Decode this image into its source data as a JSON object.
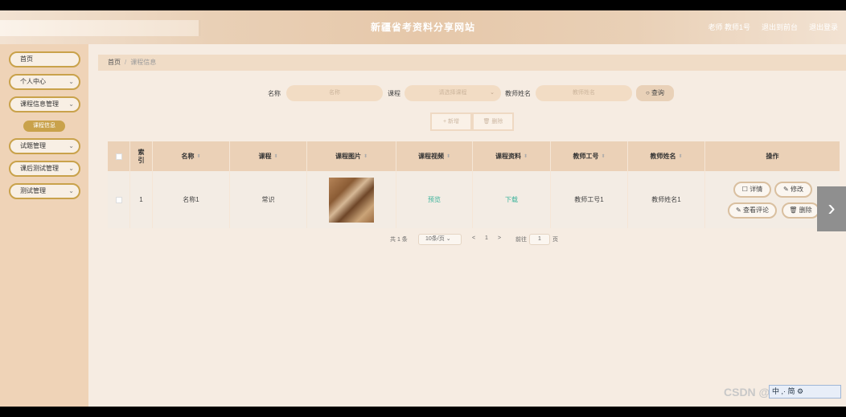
{
  "header": {
    "title": "新疆省考资料分享网站",
    "user": "老师 教师1号",
    "back_admin": "退出到前台",
    "logout": "退出登录"
  },
  "sidebar": {
    "items": [
      {
        "label": "首页"
      },
      {
        "label": "个人中心"
      },
      {
        "label": "课程信息管理"
      },
      {
        "label": "试题管理"
      },
      {
        "label": "课后测试管理"
      },
      {
        "label": "测试管理"
      }
    ],
    "active_sub": "课程信息"
  },
  "breadcrumb": {
    "home": "首页",
    "current": "课程信息"
  },
  "filters": {
    "name_label": "名称",
    "name_placeholder": "名称",
    "course_label": "课程",
    "course_placeholder": "请选择课程",
    "teacher_label": "教师姓名",
    "teacher_placeholder": "教师姓名",
    "search": "查询"
  },
  "actions": {
    "add": "新增",
    "delete": "删除"
  },
  "table": {
    "headers": [
      "索引",
      "名称",
      "课程",
      "课程图片",
      "课程视频",
      "课程资料",
      "教师工号",
      "教师姓名",
      "操作"
    ],
    "rows": [
      {
        "index": "1",
        "name": "名称1",
        "course": "常识",
        "video": "预览",
        "material": "下载",
        "teacher_no": "教师工号1",
        "teacher_name": "教师姓名1"
      }
    ],
    "ops": {
      "detail": "详情",
      "edit": "修改",
      "comment": "查看评论",
      "remove": "删除"
    }
  },
  "pager": {
    "total": "共 1 条",
    "page_size": "10条/页",
    "prev": "<",
    "page": "1",
    "next": ">",
    "goto": "前往",
    "goto_val": "1",
    "page_unit": "页"
  },
  "watermark": "CSDN @Cs_0021",
  "ime": "中 ,· 简 ⚙"
}
